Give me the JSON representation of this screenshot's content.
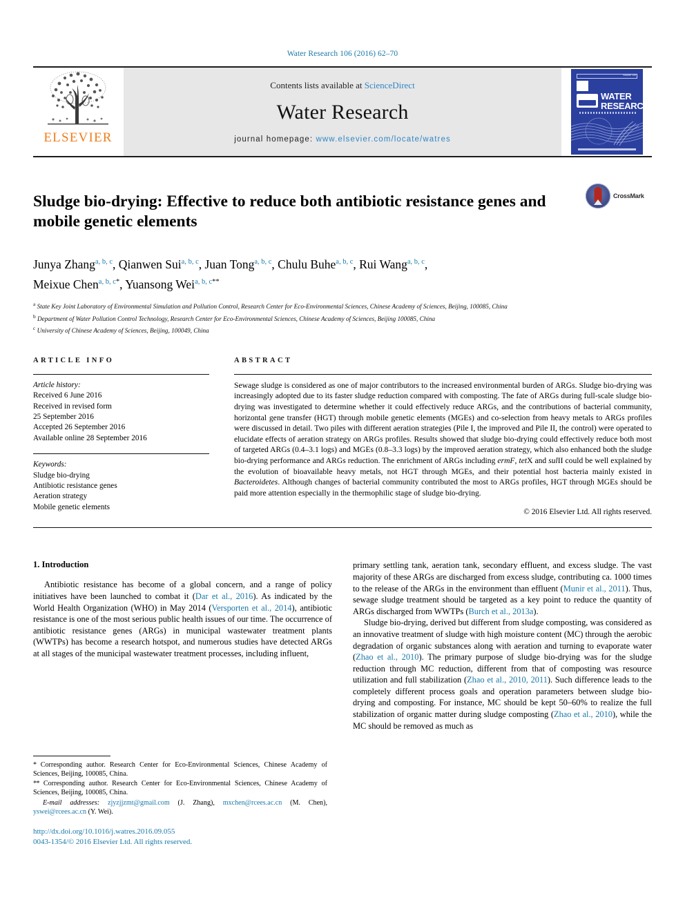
{
  "running_head": "Water Research 106 (2016) 62–70",
  "masthead": {
    "publisher_name": "ELSEVIER",
    "contents_prefix": "Contents lists available at ",
    "contents_link": "ScienceDirect",
    "journal_name": "Water Research",
    "homepage_label": "journal homepage: ",
    "homepage_url": "www.elsevier.com/locate/watres",
    "cover_title_line1": "WATER",
    "cover_title_line2": "RESEARCH",
    "cover_volume": "Volume 106"
  },
  "article": {
    "title": "Sludge bio-drying: Effective to reduce both antibiotic resistance genes and mobile genetic elements",
    "crossmark_label": "CrossMark",
    "authors": [
      {
        "name": "Junya Zhang",
        "marks": "a, b, c",
        "sep": ", "
      },
      {
        "name": "Qianwen Sui",
        "marks": "a, b, c",
        "sep": ", "
      },
      {
        "name": "Juan Tong",
        "marks": "a, b, c",
        "sep": ", "
      },
      {
        "name": "Chulu Buhe",
        "marks": "a, b, c",
        "sep": ", "
      },
      {
        "name": "Rui Wang",
        "marks": "a, b, c",
        "sep": ", "
      },
      {
        "name": "Meixue Chen",
        "marks": "a, b, c",
        "star": "*",
        "sep": ", "
      },
      {
        "name": "Yuansong Wei",
        "marks": "a, b, c",
        "star": "**",
        "sep": ""
      }
    ],
    "affiliations": [
      {
        "mark": "a",
        "text": "State Key Joint Laboratory of Environmental Simulation and Pollution Control, Research Center for Eco-Environmental Sciences, Chinese Academy of Sciences, Beijing, 100085, China"
      },
      {
        "mark": "b",
        "text": "Department of Water Pollution Control Technology, Research Center for Eco-Environmental Sciences, Chinese Academy of Sciences, Beijing 100085, China"
      },
      {
        "mark": "c",
        "text": "University of Chinese Academy of Sciences, Beijing, 100049, China"
      }
    ]
  },
  "article_info": {
    "heading": "ARTICLE INFO",
    "history_label": "Article history:",
    "history": [
      "Received 6 June 2016",
      "Received in revised form",
      "25 September 2016",
      "Accepted 26 September 2016",
      "Available online 28 September 2016"
    ],
    "keywords_label": "Keywords:",
    "keywords": [
      "Sludge bio-drying",
      "Antibiotic resistance genes",
      "Aeration strategy",
      "Mobile genetic elements"
    ]
  },
  "abstract": {
    "heading": "ABSTRACT",
    "paragraph_1": "Sewage sludge is considered as one of major contributors to the increased environmental burden of ARGs. Sludge bio-drying was increasingly adopted due to its faster sludge reduction compared with composting. The fate of ARGs during full-scale sludge bio-drying was investigated to determine whether it could effectively reduce ARGs, and the contributions of bacterial community, horizontal gene transfer (HGT) through mobile genetic elements (MGEs) and co-selection from heavy metals to ARGs profiles were discussed in detail. Two piles with different aeration strategies (Pile I, the improved and Pile II, the control) were operated to elucidate effects of aeration strategy on ARGs profiles. Results showed that sludge bio-drying could effectively reduce both most of targeted ARGs (0.4–3.1 logs) and MGEs (0.8–3.3 logs) by the improved aeration strategy, which also enhanced both the sludge bio-drying performance and ARGs reduction. The enrichment of ARGs including ",
    "italic_1": "ermF",
    "mid_1": ", ",
    "italic_2": "tet",
    "mid_2": "X and ",
    "italic_3": "sul",
    "mid_3": "II could be well explained by the evolution of bioavailable heavy metals, not HGT through MGEs, and their potential host bacteria mainly existed in ",
    "italic_4": "Bacteroidetes",
    "tail": ". Although changes of bacterial community contributed the most to ARGs profiles, HGT through MGEs should be paid more attention especially in the thermophilic stage of sludge bio-drying.",
    "copyright": "© 2016 Elsevier Ltd. All rights reserved."
  },
  "introduction": {
    "heading": "1. Introduction",
    "left_p1_a": "Antibiotic resistance has become of a global concern, and a range of policy initiatives have been launched to combat it (",
    "left_ref1": "Dar et al., 2016",
    "left_p1_b": "). As indicated by the World Health Organization (WHO) in May 2014 (",
    "left_ref2": "Versporten et al., 2014",
    "left_p1_c": "), antibiotic resistance is one of the most serious public health issues of our time. The occurrence of antibiotic resistance genes (ARGs) in municipal wastewater treatment plants (WWTPs) has become a research hotspot, and numerous studies have detected ARGs at all stages of the municipal wastewater treatment processes, including influent,",
    "right_p1_a": "primary settling tank, aeration tank, secondary effluent, and excess sludge. The vast majority of these ARGs are discharged from excess sludge, contributing ca. 1000 times to the release of the ARGs in the environment than effluent (",
    "right_ref1": "Munir et al., 2011",
    "right_p1_b": "). Thus, sewage sludge treatment should be targeted as a key point to reduce the quantity of ARGs discharged from WWTPs (",
    "right_ref2": "Burch et al., 2013a",
    "right_p1_c": ").",
    "right_p2_a": "Sludge bio-drying, derived but different from sludge composting, was considered as an innovative treatment of sludge with high moisture content (MC) through the aerobic degradation of organic substances along with aeration and turning to evaporate water (",
    "right_ref3": "Zhao et al., 2010",
    "right_p2_b": "). The primary purpose of sludge bio-drying was for the sludge reduction through MC reduction, different from that of composting was resource utilization and full stabilization (",
    "right_ref4": "Zhao et al., 2010, 2011",
    "right_p2_c": "). Such difference leads to the completely different process goals and operation parameters between sludge bio-drying and composting. For instance, MC should be kept 50–60% to realize the full stabilization of organic matter during sludge composting (",
    "right_ref5": "Zhao et al., 2010",
    "right_p2_d": "), while the MC should be removed as much as"
  },
  "footnotes": {
    "note1_star": "*",
    "note1": " Corresponding author. Research Center for Eco-Environmental Sciences, Chinese Academy of Sciences, Beijing, 100085, China.",
    "note2_star": "**",
    "note2": " Corresponding author. Research Center for Eco-Environmental Sciences, Chinese Academy of Sciences, Beijing, 100085, China.",
    "email_label": "E-mail addresses:",
    "emails": [
      {
        "addr": "zjyzjjzmt@gmail.com",
        "who": " (J. Zhang), "
      },
      {
        "addr": "mxchen@rcees.ac.cn",
        "who": " (M. Chen), "
      },
      {
        "addr": "yswei@rcees.ac.cn",
        "who": " (Y. Wei)."
      }
    ],
    "doi": "http://dx.doi.org/10.1016/j.watres.2016.09.055",
    "issn_line": "0043-1354/© 2016 Elsevier Ltd. All rights reserved."
  }
}
